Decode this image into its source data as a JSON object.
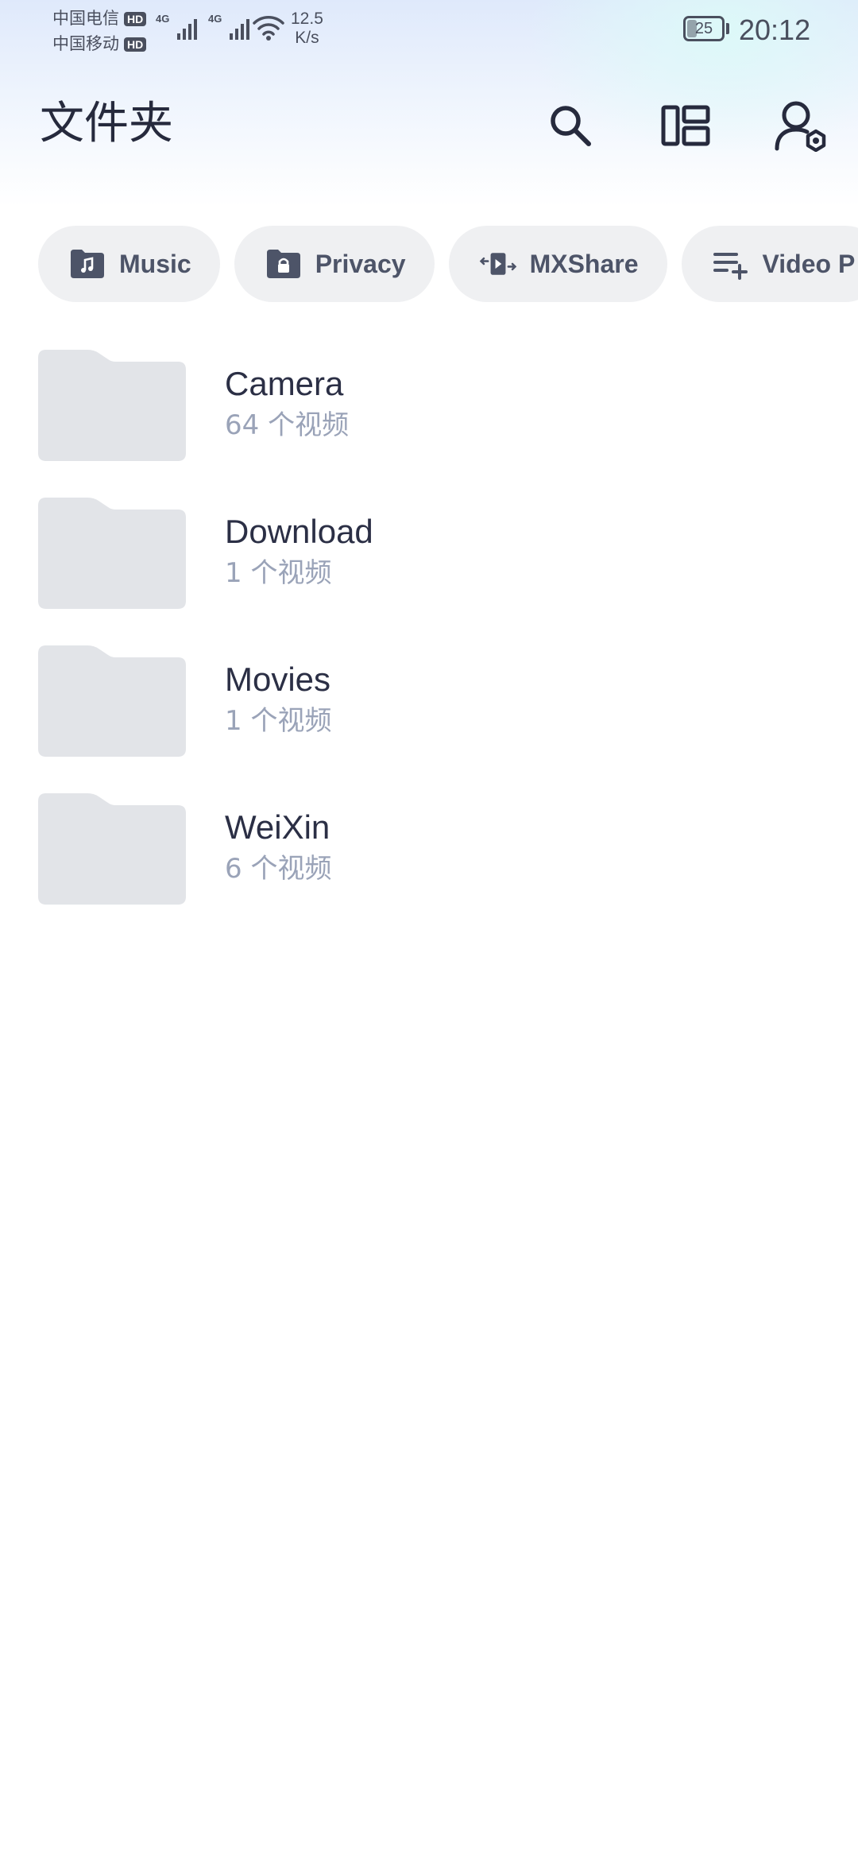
{
  "status_bar": {
    "carriers": [
      {
        "name": "中国电信",
        "badge": "HD"
      },
      {
        "name": "中国移动",
        "badge": "HD"
      }
    ],
    "network_type": "4G",
    "net_speed_value": "12.5",
    "net_speed_unit": "K/s",
    "battery_level": "25",
    "time": "20:12"
  },
  "header": {
    "title": "文件夹",
    "icons": [
      "search-icon",
      "layout-toggle-icon",
      "account-settings-icon"
    ]
  },
  "chips": [
    {
      "label": "Music",
      "icon": "music-folder-icon"
    },
    {
      "label": "Privacy",
      "icon": "lock-folder-icon"
    },
    {
      "label": "MXShare",
      "icon": "share-transfer-icon"
    },
    {
      "label": "Video P",
      "icon": "playlist-add-icon"
    }
  ],
  "folders": [
    {
      "name": "Camera",
      "count": "64 个视频"
    },
    {
      "name": "Download",
      "count": "1 个视频"
    },
    {
      "name": "Movies",
      "count": "1 个视频"
    },
    {
      "name": "WeiXin",
      "count": "6 个视频"
    }
  ],
  "colors": {
    "chip_background": "#eff0f2",
    "chip_text": "#4d5468",
    "folder_thumb": "#e2e4e8",
    "folder_name": "#2b2f45",
    "folder_count": "#9aa3b8"
  }
}
